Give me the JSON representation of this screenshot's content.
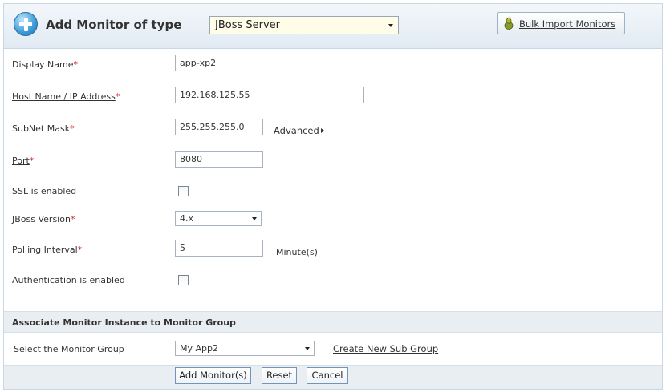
{
  "header": {
    "title": "Add Monitor of type",
    "monitor_type": "JBoss Server",
    "bulk_import_label": "Bulk Import Monitors"
  },
  "form": {
    "display_name": {
      "label": "Display Name",
      "value": "app-xp2"
    },
    "host": {
      "label": "Host Name / IP Address",
      "value": "192.168.125.55"
    },
    "subnet": {
      "label": "SubNet Mask",
      "value": "255.255.255.0",
      "advanced_label": "Advanced"
    },
    "port": {
      "label": "Port",
      "value": "8080"
    },
    "ssl": {
      "label": "SSL is enabled",
      "checked": false
    },
    "jboss_version": {
      "label": "JBoss Version",
      "value": "4.x"
    },
    "polling": {
      "label": "Polling Interval",
      "value": "5",
      "unit": "Minute(s)"
    },
    "auth": {
      "label": "Authentication is enabled",
      "checked": false
    },
    "required_mark": "*"
  },
  "group_section": {
    "title": "Associate Monitor Instance to Monitor Group",
    "select_label": "Select the Monitor Group",
    "selected_group": "My App2",
    "create_link": "Create New Sub Group"
  },
  "buttons": {
    "add": "Add Monitor(s)",
    "reset": "Reset",
    "cancel": "Cancel"
  },
  "colors": {
    "required": "#d32f2f",
    "type_select_bg": "#fffde8",
    "section_bg": "#e9eef3"
  }
}
